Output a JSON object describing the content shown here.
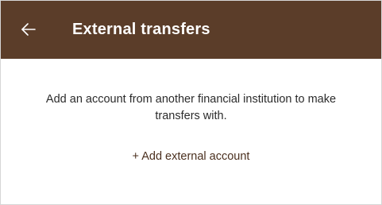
{
  "header": {
    "title": "External transfers",
    "back_icon": "arrow-left-icon",
    "background_color": "#5b3d29"
  },
  "main": {
    "message": "Add an account from another financial institution to make transfers with.",
    "add_account_label": "+ Add external account",
    "link_color": "#4a2f1e"
  }
}
